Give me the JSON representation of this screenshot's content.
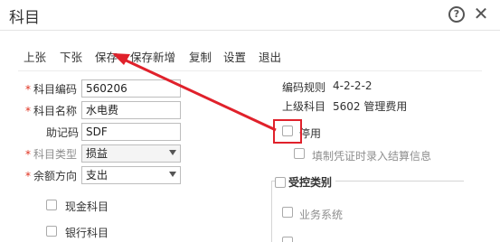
{
  "dialog": {
    "title": "科目"
  },
  "toolbar": {
    "prev": "上张",
    "next": "下张",
    "save": "保存",
    "save_new": "保存新增",
    "copy": "复制",
    "settings": "设置",
    "exit": "退出"
  },
  "form": {
    "code": {
      "label": "科目编码",
      "value": "560206"
    },
    "name": {
      "label": "科目名称",
      "value": "水电费"
    },
    "mnemonic": {
      "label": "助记码",
      "value": "SDF"
    },
    "type": {
      "label": "科目类型",
      "value": "损益"
    },
    "direction": {
      "label": "余额方向",
      "value": "支出"
    },
    "cash": {
      "label": "现金科目"
    },
    "bank": {
      "label": "银行科目"
    }
  },
  "right": {
    "rule": {
      "label": "编码规则",
      "value": "4-2-2-2"
    },
    "parent": {
      "label": "上级科目",
      "value": "5602 管理费用"
    },
    "disabled": {
      "label": "停用"
    },
    "settle": {
      "label": "填制凭证时录入结算信息"
    },
    "group": {
      "title": "受控类别"
    },
    "business": {
      "label": "业务系统"
    }
  },
  "annotation": {
    "color": "#e0212b"
  }
}
